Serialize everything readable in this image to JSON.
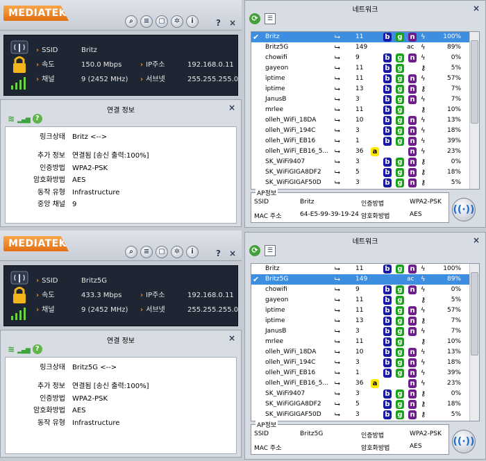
{
  "brand": "MEDIATEK",
  "window_buttons": {
    "help": "?",
    "close": "×"
  },
  "toolbar_icons": [
    "search-icon",
    "list-icon",
    "document-icon",
    "gear-icon",
    "info-icon"
  ],
  "labels": {
    "ssid": "SSID",
    "speed": "속도",
    "channel": "채널",
    "ip": "IP주소",
    "subnet": "서브넷",
    "conn_title": "연결 정보",
    "link_status": "링크상태",
    "extra_info": "추가 정보",
    "auth": "인증방법",
    "encryption": "암호화방법",
    "op_mode": "동작 유형",
    "center_channel": "중앙 채널",
    "net_title": "네트워크",
    "ap_info": "AP정보",
    "mac": "MAC 주소"
  },
  "panels": [
    {
      "ssid": "Britz",
      "speed": "150.0 Mbps",
      "channel": "9 (2452 MHz)",
      "ip": "192.168.0.11",
      "subnet": "255.255.255.0",
      "link_status": "Britz <-->",
      "extra_info": "연결됨 [송신 출력:100%]",
      "auth": "WPA2-PSK",
      "encryption": "AES",
      "op_mode": "Infrastructure",
      "center_channel": "9"
    },
    {
      "ssid": "Britz5G",
      "speed": "433.3 Mbps",
      "channel": "9 (2452 MHz)",
      "ip": "192.168.0.11",
      "subnet": "255.255.255.0",
      "link_status": "Britz5G <-->",
      "extra_info": "연결됨 [송신 출력:100%]",
      "auth": "WPA2-PSK",
      "encryption": "AES",
      "op_mode": "Infrastructure",
      "center_channel": ""
    }
  ],
  "networks": [
    {
      "selected_index": 0,
      "ap": {
        "ssid": "Britz",
        "auth": "WPA2-PSK",
        "mac": "64-E5-99-39-19-24",
        "enc": "AES"
      },
      "rows": [
        {
          "name": "Britz",
          "ch": "11",
          "a": false,
          "b": true,
          "g": true,
          "n": true,
          "ac": false,
          "lock": true,
          "pct": "100%"
        },
        {
          "name": "Britz5G",
          "ch": "149",
          "a": false,
          "b": false,
          "g": false,
          "n": false,
          "ac": true,
          "lock": true,
          "pct": "89%"
        },
        {
          "name": "chowifi",
          "ch": "9",
          "a": false,
          "b": true,
          "g": true,
          "n": true,
          "ac": false,
          "lock": true,
          "pct": "0%"
        },
        {
          "name": "gayeon",
          "ch": "11",
          "a": false,
          "b": true,
          "g": true,
          "n": false,
          "ac": false,
          "lock": false,
          "pct": "5%"
        },
        {
          "name": "iptime",
          "ch": "11",
          "a": false,
          "b": true,
          "g": true,
          "n": true,
          "ac": false,
          "lock": true,
          "pct": "57%"
        },
        {
          "name": "iptime",
          "ch": "13",
          "a": false,
          "b": true,
          "g": true,
          "n": true,
          "ac": false,
          "lock": false,
          "pct": "7%"
        },
        {
          "name": "JanusB",
          "ch": "3",
          "a": false,
          "b": true,
          "g": true,
          "n": true,
          "ac": false,
          "lock": true,
          "pct": "7%"
        },
        {
          "name": "mrlee",
          "ch": "11",
          "a": false,
          "b": true,
          "g": true,
          "n": false,
          "ac": false,
          "lock": false,
          "pct": "10%"
        },
        {
          "name": "olleh_WiFi_18DA",
          "ch": "10",
          "a": false,
          "b": true,
          "g": true,
          "n": true,
          "ac": false,
          "lock": true,
          "pct": "13%"
        },
        {
          "name": "olleh_WiFi_194C",
          "ch": "3",
          "a": false,
          "b": true,
          "g": true,
          "n": true,
          "ac": false,
          "lock": true,
          "pct": "18%"
        },
        {
          "name": "olleh_WiFi_EB16",
          "ch": "1",
          "a": false,
          "b": true,
          "g": true,
          "n": true,
          "ac": false,
          "lock": true,
          "pct": "39%"
        },
        {
          "name": "olleh_WiFi_EB16_5...",
          "ch": "36",
          "a": true,
          "b": false,
          "g": false,
          "n": true,
          "ac": false,
          "lock": true,
          "pct": "23%"
        },
        {
          "name": "SK_WiFi9407",
          "ch": "3",
          "a": false,
          "b": true,
          "g": true,
          "n": true,
          "ac": false,
          "lock": false,
          "pct": "0%"
        },
        {
          "name": "SK_WiFiGIGA8DF2",
          "ch": "5",
          "a": false,
          "b": true,
          "g": true,
          "n": true,
          "ac": false,
          "lock": false,
          "pct": "18%"
        },
        {
          "name": "SK_WiFiGIGAF50D",
          "ch": "3",
          "a": false,
          "b": true,
          "g": true,
          "n": true,
          "ac": false,
          "lock": false,
          "pct": "5%"
        }
      ]
    },
    {
      "selected_index": 1,
      "ap": {
        "ssid": "Britz5G",
        "auth": "WPA2-PSK",
        "mac": "",
        "enc": "AES"
      },
      "rows": [
        {
          "name": "Britz",
          "ch": "11",
          "a": false,
          "b": true,
          "g": true,
          "n": true,
          "ac": false,
          "lock": true,
          "pct": "100%"
        },
        {
          "name": "Britz5G",
          "ch": "149",
          "a": false,
          "b": false,
          "g": false,
          "n": false,
          "ac": true,
          "lock": true,
          "pct": "89%"
        },
        {
          "name": "chowifi",
          "ch": "9",
          "a": false,
          "b": true,
          "g": true,
          "n": true,
          "ac": false,
          "lock": true,
          "pct": "0%"
        },
        {
          "name": "gayeon",
          "ch": "11",
          "a": false,
          "b": true,
          "g": true,
          "n": false,
          "ac": false,
          "lock": false,
          "pct": "5%"
        },
        {
          "name": "iptime",
          "ch": "11",
          "a": false,
          "b": true,
          "g": true,
          "n": true,
          "ac": false,
          "lock": true,
          "pct": "57%"
        },
        {
          "name": "iptime",
          "ch": "13",
          "a": false,
          "b": true,
          "g": true,
          "n": true,
          "ac": false,
          "lock": false,
          "pct": "7%"
        },
        {
          "name": "JanusB",
          "ch": "3",
          "a": false,
          "b": true,
          "g": true,
          "n": true,
          "ac": false,
          "lock": true,
          "pct": "7%"
        },
        {
          "name": "mrlee",
          "ch": "11",
          "a": false,
          "b": true,
          "g": true,
          "n": false,
          "ac": false,
          "lock": false,
          "pct": "10%"
        },
        {
          "name": "olleh_WiFi_18DA",
          "ch": "10",
          "a": false,
          "b": true,
          "g": true,
          "n": true,
          "ac": false,
          "lock": true,
          "pct": "13%"
        },
        {
          "name": "olleh_WiFi_194C",
          "ch": "3",
          "a": false,
          "b": true,
          "g": true,
          "n": true,
          "ac": false,
          "lock": true,
          "pct": "18%"
        },
        {
          "name": "olleh_WiFi_EB16",
          "ch": "1",
          "a": false,
          "b": true,
          "g": true,
          "n": true,
          "ac": false,
          "lock": true,
          "pct": "39%"
        },
        {
          "name": "olleh_WiFi_EB16_5...",
          "ch": "36",
          "a": true,
          "b": false,
          "g": false,
          "n": true,
          "ac": false,
          "lock": true,
          "pct": "23%"
        },
        {
          "name": "SK_WiFi9407",
          "ch": "3",
          "a": false,
          "b": true,
          "g": true,
          "n": true,
          "ac": false,
          "lock": false,
          "pct": "0%"
        },
        {
          "name": "SK_WiFiGIGA8DF2",
          "ch": "5",
          "a": false,
          "b": true,
          "g": true,
          "n": true,
          "ac": false,
          "lock": false,
          "pct": "18%"
        },
        {
          "name": "SK_WiFiGIGAF50D",
          "ch": "3",
          "a": false,
          "b": true,
          "g": true,
          "n": true,
          "ac": false,
          "lock": false,
          "pct": "5%"
        }
      ]
    }
  ]
}
